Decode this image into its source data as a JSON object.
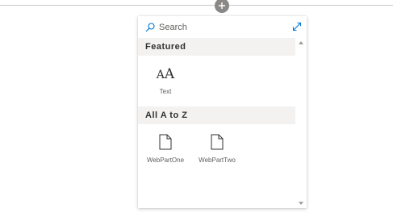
{
  "search": {
    "placeholder": "Search"
  },
  "sections": [
    {
      "title": "Featured",
      "items": [
        {
          "label": "Text",
          "icon": "text-icon"
        }
      ]
    },
    {
      "title": "All A to Z",
      "items": [
        {
          "label": "WebPartOne",
          "icon": "page-icon"
        },
        {
          "label": "WebPartTwo",
          "icon": "page-icon"
        }
      ]
    }
  ],
  "icons": {
    "add": "plus-icon",
    "search": "search-icon",
    "expand": "expand-icon"
  },
  "colors": {
    "accent": "#0078d4",
    "add_button": "#8a8886",
    "section_bg": "#f3f2f1"
  }
}
